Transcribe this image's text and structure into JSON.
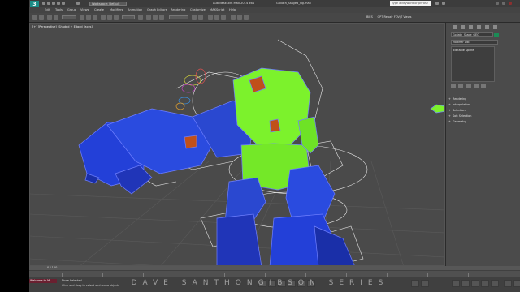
{
  "titlebar": {
    "app_logo": "3",
    "workspace": "Workspace: Default",
    "app_title": "Autodesk 3ds Max 2014 x64",
    "file_title": "Goliath_Stage3_rig.max",
    "search_placeholder": "Type a keyword or phrase"
  },
  "menubar": {
    "items": [
      "Edit",
      "Tools",
      "Group",
      "Views",
      "Create",
      "Modifiers",
      "Animation",
      "Graph Editors",
      "Rendering",
      "Customize",
      "MAXScript",
      "Help"
    ]
  },
  "ribbon": {
    "label_left": "BIES",
    "label_right": "GPT Repair FOV/T Views"
  },
  "viewport": {
    "label": "[+] [Perspective] [Shaded + Edged Faces]",
    "colors": {
      "background": "#4a4a4a",
      "green": "#7cf22c",
      "blue": "#2440d8",
      "orange": "#c0501a",
      "rig": "#e8e8e8"
    }
  },
  "command_panel": {
    "object_name": "Goliath_Stage_GEO",
    "modifier_list": "Modifier List",
    "stack_item": "Editable Spline",
    "rollouts": [
      "Rendering",
      "Interpolation",
      "Selection",
      "Soft Selection",
      "Geometry"
    ]
  },
  "timeline": {
    "frame_label": "0 / 100"
  },
  "status": {
    "maxscript_label": "Welcome to M",
    "line1": "None Selected",
    "line2": "Click and drag to select and move objects"
  },
  "watermark": "DAVE SANTHONGIBSON SERIES"
}
